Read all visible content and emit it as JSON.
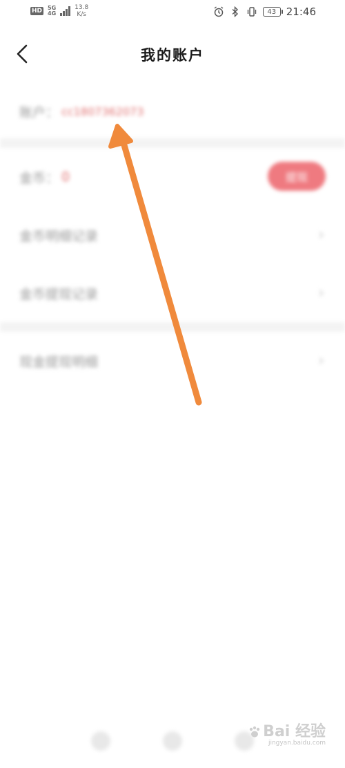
{
  "status_bar": {
    "hd_label": "HD",
    "net_type_top": "5G",
    "net_type_bottom": "4G",
    "speed_value": "13.8",
    "speed_unit": "K/s",
    "battery_level": "43",
    "time": "21:46"
  },
  "header": {
    "title": "我的账户"
  },
  "account": {
    "label": "账户：",
    "value": "cc1807362073"
  },
  "coins": {
    "label": "金币：",
    "value": "0",
    "action_label": "提现"
  },
  "menu_items": [
    {
      "label": "金币明细记录"
    },
    {
      "label": "金币提现记录"
    },
    {
      "label": "现金提现明细"
    }
  ],
  "watermark": {
    "main": "Bai 经验",
    "sub": "jingyan.baidu.com"
  },
  "colors": {
    "accent": "#f08a3c",
    "pill": "#ef7a80",
    "account_value": "#e07070"
  }
}
